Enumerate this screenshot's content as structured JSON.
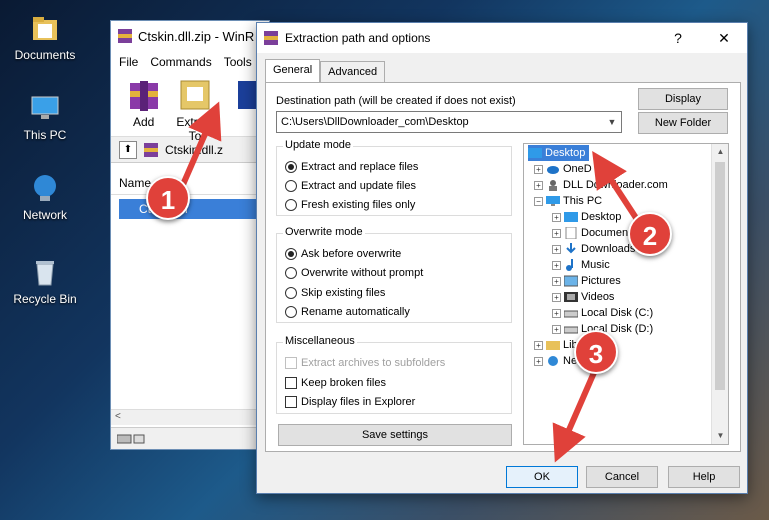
{
  "desktop": {
    "icons": [
      {
        "label": "Documents"
      },
      {
        "label": "This PC"
      },
      {
        "label": "Network"
      },
      {
        "label": "Recycle Bin"
      }
    ]
  },
  "winrar": {
    "title": "Ctskin.dll.zip - WinR",
    "menu": [
      "File",
      "Commands",
      "Tools"
    ],
    "toolbar": [
      {
        "label": "Add"
      },
      {
        "label": "Extract To"
      }
    ],
    "address": "Ctskin.dll.z",
    "column_name": "Name",
    "file_row": "Ctskin.dll"
  },
  "dialog": {
    "title": "Extraction path and options",
    "help": "?",
    "close": "✕",
    "tabs": [
      "General",
      "Advanced"
    ],
    "dest_label": "Destination path (will be created if does not exist)",
    "dest_value": "C:\\Users\\DllDownloader_com\\Desktop",
    "display_btn": "Display",
    "new_folder_btn": "New Folder",
    "update_mode": {
      "title": "Update mode",
      "options": [
        "Extract and replace files",
        "Extract and update files",
        "Fresh existing files only"
      ],
      "selected": 0
    },
    "overwrite_mode": {
      "title": "Overwrite mode",
      "options": [
        "Ask before overwrite",
        "Overwrite without prompt",
        "Skip existing files",
        "Rename automatically"
      ],
      "selected": 0
    },
    "misc": {
      "title": "Miscellaneous",
      "options": [
        "Extract archives to subfolders",
        "Keep broken files",
        "Display files in Explorer"
      ]
    },
    "save_settings": "Save settings",
    "tree": {
      "root": "Desktop",
      "items": [
        "OneD",
        "DLL Downloader.com",
        "This PC",
        "Desktop",
        "Documen",
        "Downloads",
        "Music",
        "Pictures",
        "Videos",
        "Local Disk (C:)",
        "Local Disk (D:)",
        "Libr",
        "Netw"
      ]
    },
    "ok": "OK",
    "cancel": "Cancel",
    "help_btn": "Help"
  },
  "callouts": [
    "1",
    "2",
    "3"
  ],
  "colors": {
    "accent": "#0078d7",
    "callout": "#e0413a",
    "selection": "#cce4f7"
  }
}
